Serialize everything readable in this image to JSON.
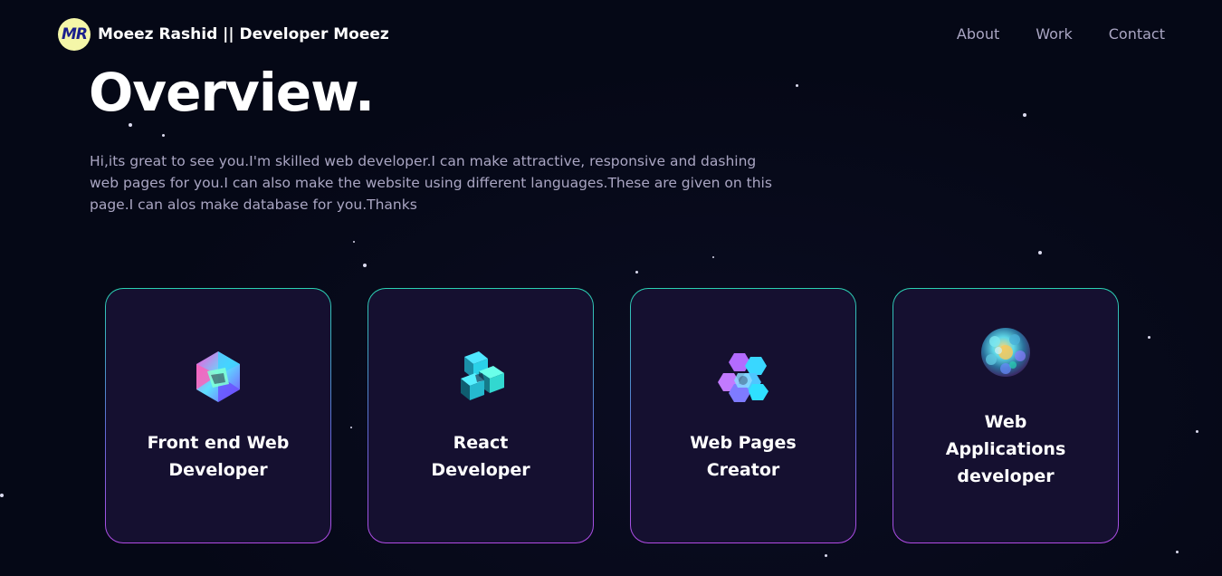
{
  "navbar": {
    "logo_text": "MR",
    "brand_name": "Moeez Rashid || Developer Moeez",
    "links": [
      {
        "label": "About"
      },
      {
        "label": "Work"
      },
      {
        "label": "Contact"
      }
    ]
  },
  "overview": {
    "title": "Overview.",
    "text": "Hi,its great to see you.I'm skilled web developer.I can make attractive, responsive and dashing web pages for you.I can also make the website using different languages.These are given on this page.I can alos make database for you.Thanks"
  },
  "services": [
    {
      "title": "Front end Web Developer",
      "icon": "icosahedron-icon"
    },
    {
      "title": "React Developer",
      "icon": "cube-cluster-icon"
    },
    {
      "title": "Web Pages Creator",
      "icon": "hexagon-cluster-icon"
    },
    {
      "title": "Web Applications developer",
      "icon": "sphere-icon"
    }
  ],
  "colors": {
    "background": "#050816",
    "card_background": "#151030",
    "secondary_text": "#aaa6c3",
    "border_top": "#2ad1b2",
    "border_bottom": "#b24be6"
  }
}
